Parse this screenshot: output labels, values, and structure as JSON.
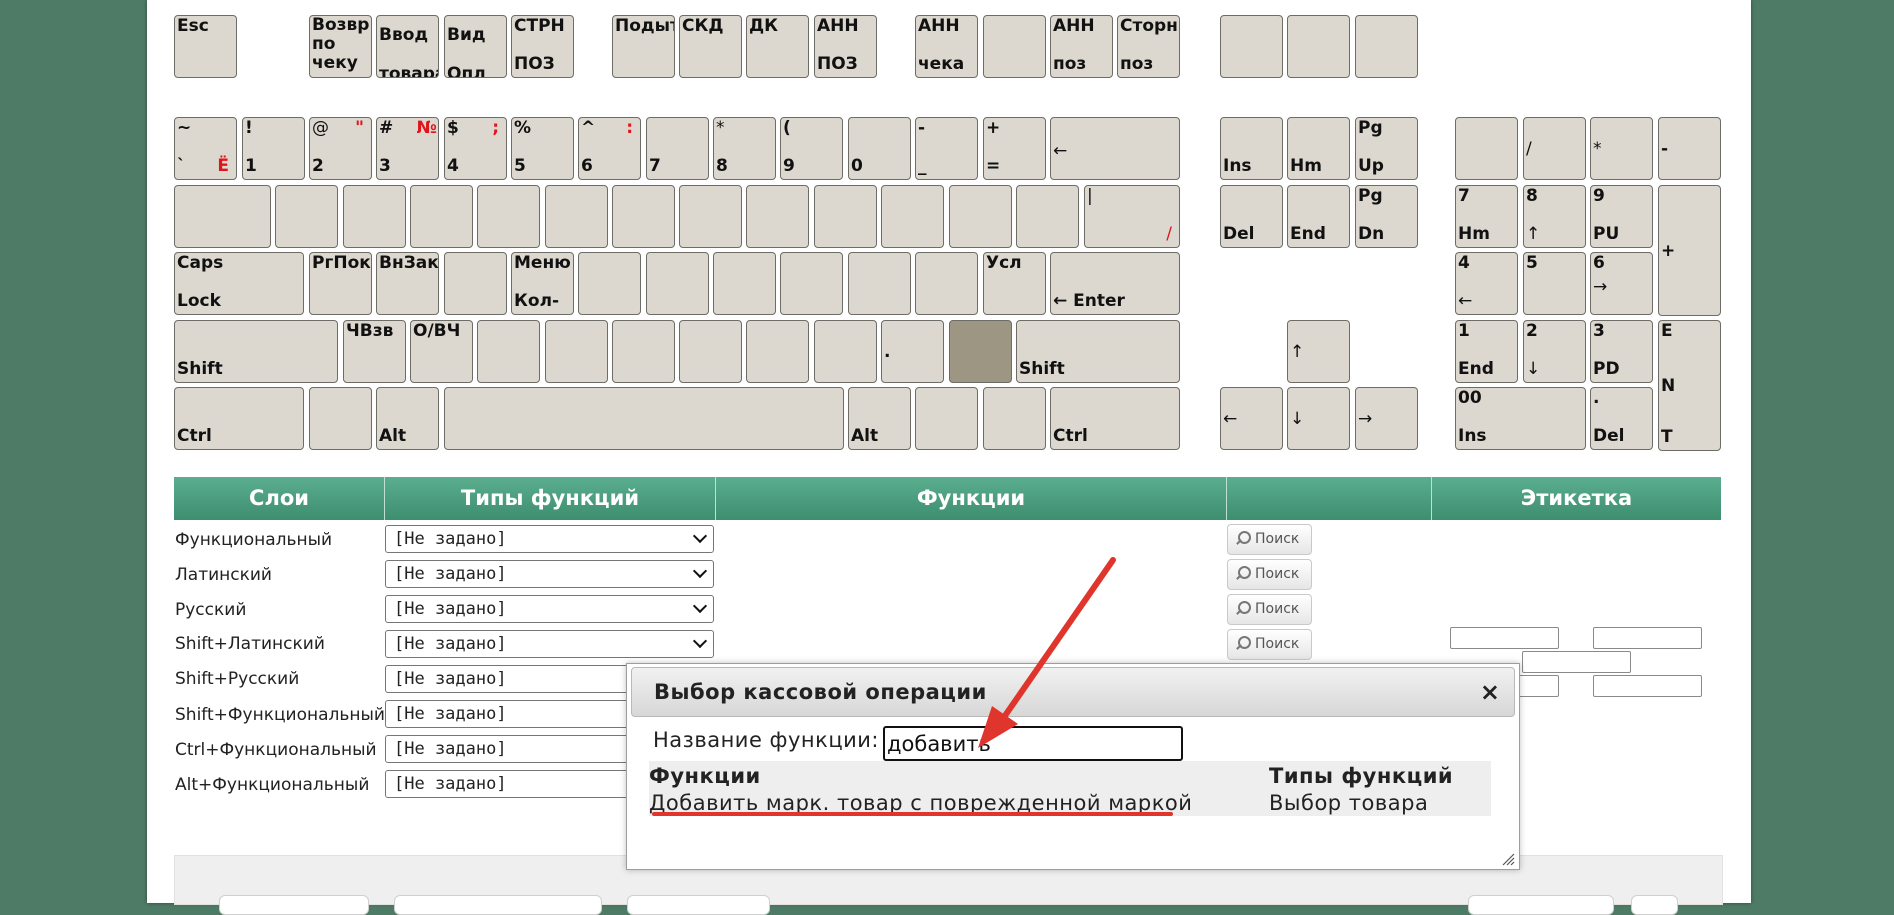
{
  "keyboard": {
    "fn_row": {
      "esc": "Esc",
      "vozvr": "Возвр\nпо\nчеку",
      "vvod": "Ввод\nтовара",
      "vid": "Вид\nОпл",
      "strn_top": "СТРН",
      "strn_bottom": "ПОЗ",
      "podyt": "Подыт",
      "skd": "СКД",
      "dk": "ДК",
      "ann1_top": "АНН",
      "ann1_bottom": "ПОЗ",
      "ann2_top": "АНН",
      "ann2_bottom": "чека",
      "ann3_top": "АНН",
      "ann3_bottom": "поз",
      "storn_top": "Сторн",
      "storn_bottom": "поз"
    },
    "num_row": [
      {
        "top": "~",
        "bottom": "`",
        "red_bottom": "Ё"
      },
      {
        "top": "!",
        "bottom": "1"
      },
      {
        "top": "@",
        "bottom": "2",
        "red_top": "\""
      },
      {
        "top": "#",
        "bottom": "3",
        "red_top": "№"
      },
      {
        "top": "$",
        "bottom": "4",
        "red_top": ";"
      },
      {
        "top": "%",
        "bottom": "5"
      },
      {
        "top": "^",
        "bottom": "6",
        "red_top": ":"
      },
      {
        "top": "",
        "bottom": "7"
      },
      {
        "top": "*",
        "bottom": "8"
      },
      {
        "top": "(",
        "bottom": "9"
      },
      {
        "top": "",
        "bottom": "0"
      },
      {
        "top": "-",
        "bottom": "_"
      },
      {
        "top": "+",
        "bottom": "="
      },
      {
        "top": "",
        "bottom": "←"
      }
    ],
    "tab_row": {
      "pipe": "|",
      "slash_red": "/"
    },
    "caps_row": {
      "caps_top": "Caps",
      "caps_bottom": "Lock",
      "rgpok": "РгПок",
      "vnzak": "ВнЗак",
      "menu_top": "Меню",
      "menu_bottom": "Кол-",
      "usl": "Усл",
      "enter": "← Enter"
    },
    "shift_row": {
      "shift_left": "Shift",
      "chvzv": "ЧВзв",
      "o_vch": "О/ВЧ",
      "dot": ".",
      "shift_right": "Shift"
    },
    "ctrl_row": {
      "ctrl_left": "Ctrl",
      "alt_left": "Alt",
      "alt_right": "Alt",
      "ctrl_right": "Ctrl"
    },
    "nav": {
      "ins": "Ins",
      "hm": "Hm",
      "pgup_top": "Pg",
      "pgup_bottom": "Up",
      "del": "Del",
      "end": "End",
      "pgdn_top": "Pg",
      "pgdn_bottom": "Dn",
      "up": "↑",
      "left": "←",
      "down": "↓",
      "right": "→"
    },
    "numpad": {
      "slash": "/",
      "star": "*",
      "minus": "-",
      "plus": "+",
      "k7_top": "7",
      "k7_bottom": "Hm",
      "k8_top": "8",
      "k8_bottom": "↑",
      "k9_top": "9",
      "k9_bottom": "PU",
      "k4_top": "4",
      "k4_bottom": "←",
      "k5": "5",
      "k6_top": "6",
      "k6_bottom": "→",
      "k1_top": "1",
      "k1_bottom": "End",
      "k2_top": "2",
      "k2_bottom": "↓",
      "k3_top": "3",
      "k3_bottom": "PD",
      "k0_top": "00",
      "k0_bottom": "Ins",
      "kdot_top": ".",
      "kdot_bottom": "Del",
      "enter_e": "E",
      "enter_n": "N",
      "enter_t": "T"
    }
  },
  "table": {
    "headers": {
      "layers": "Слои",
      "types": "Типы функций",
      "functions": "Функции",
      "label": "Этикетка"
    },
    "rows": [
      {
        "layer": "Функциональный",
        "type": "[Не задано]"
      },
      {
        "layer": "Латинский",
        "type": "[Не задано]"
      },
      {
        "layer": "Русский",
        "type": "[Не задано]"
      },
      {
        "layer": "Shift+Латинский",
        "type": "[Не задано]"
      },
      {
        "layer": "Shift+Русский",
        "type": "[Не задано]"
      },
      {
        "layer": "Shift+Функциональный",
        "type": "[Не задано]"
      },
      {
        "layer": "Ctrl+Функциональный",
        "type": "[Не задано]"
      },
      {
        "layer": "Alt+Функциональный",
        "type": "[Не задано]"
      }
    ],
    "search_label": "Поиск"
  },
  "dialog": {
    "title": "Выбор кассовой операции",
    "close": "×",
    "function_name_label": "Название функции:",
    "function_name_value": "добавить",
    "results_header_function": "Функции",
    "results_header_type": "Типы функций",
    "result_function": "Добавить марк. товар с поврежденной маркой",
    "result_type": "Выбор товара"
  },
  "colors": {
    "background": "#4d7b66",
    "table_header": "#3e8e70",
    "key": "#dcd8cf",
    "key_active": "#9c9682",
    "annotation": "#e0352c"
  }
}
